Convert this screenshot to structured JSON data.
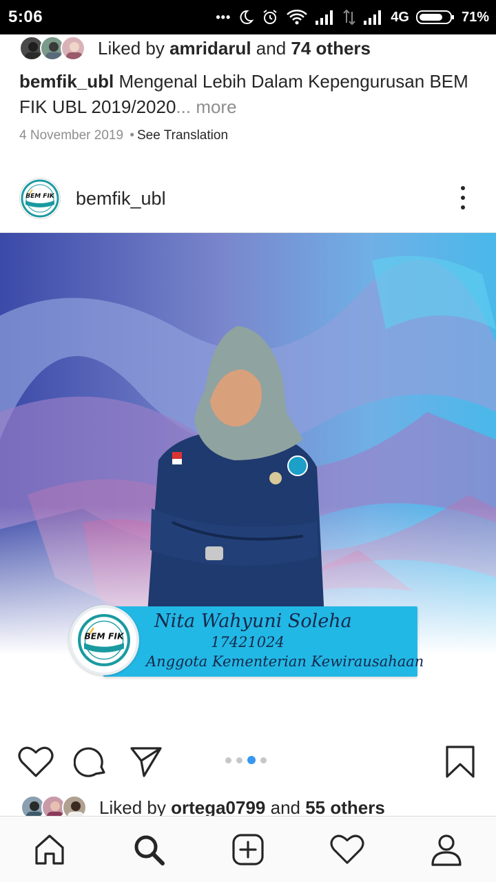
{
  "status_bar": {
    "time": "5:06",
    "dots": "•••",
    "network": "4G",
    "battery": "71%"
  },
  "previous_post": {
    "likes": {
      "prefix": "Liked by ",
      "user": "amridarul",
      "middle": " and ",
      "count": "74 others"
    },
    "caption": {
      "user": "bemfik_ubl",
      "text": " Mengenal Lebih Dalam Kepengurusan BEM FIK UBL 2019/2020",
      "ellipsis": "...",
      "more": " more"
    },
    "date": "4 November 2019",
    "separator": "•",
    "see_translation": "See Translation"
  },
  "post": {
    "username": "bemfik_ubl",
    "logo_text": "BEM FIK",
    "card": {
      "name": "Nita Wahyuni Soleha",
      "id": "17421024",
      "role": "Anggota Kementerian Kewirausahaan"
    },
    "carousel": {
      "total": 4,
      "active_index": 2
    },
    "likes": {
      "prefix": "Liked by ",
      "user": "ortega0799",
      "middle": " and ",
      "count": "55 others"
    }
  },
  "icons": {
    "like": "heart-icon",
    "comment": "comment-icon",
    "share": "send-icon",
    "save": "bookmark-icon",
    "more": "more-vertical-icon"
  },
  "bottom_nav": [
    "home-icon",
    "search-icon",
    "add-post-icon",
    "activity-heart-icon",
    "profile-icon"
  ],
  "colors": {
    "accent_blue": "#3897f0",
    "card_band": "#22b8e6",
    "text": "#262626",
    "muted": "#8e8e8e"
  }
}
